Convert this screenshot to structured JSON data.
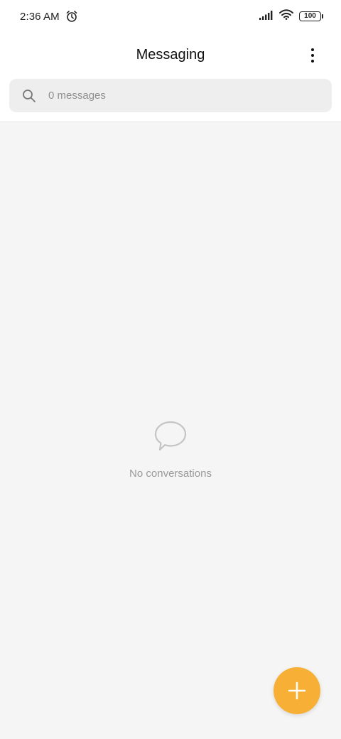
{
  "status_bar": {
    "time": "2:36 AM",
    "battery_level": "100",
    "icons": [
      "alarm-icon",
      "signal-icon",
      "wifi-icon",
      "battery-icon"
    ]
  },
  "header": {
    "title": "Messaging",
    "menu_icon": "more-vertical-icon"
  },
  "search": {
    "placeholder": "0 messages",
    "value": "",
    "icon": "search-icon"
  },
  "empty_state": {
    "icon": "chat-bubble-icon",
    "text": "No conversations"
  },
  "fab": {
    "icon": "plus-icon"
  },
  "colors": {
    "accent": "#f7b035",
    "background": "#f5f5f5",
    "surface": "#ffffff",
    "search_bg": "#eeeeee",
    "muted_text": "#999999"
  }
}
